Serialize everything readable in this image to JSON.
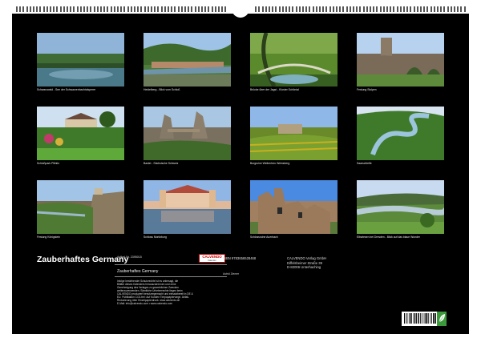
{
  "calendar": {
    "title": "Zauberhaftes Germany",
    "photos": [
      {
        "caption": "Schwarzwald - See der Schwarzenbachtalsperre",
        "icon": "lake-reflection"
      },
      {
        "caption": "Heidelberg - Blick vom Schloß",
        "icon": "town-valley"
      },
      {
        "caption": "Brücke über der Jagst - Kloster Schöntal",
        "icon": "forest-bridge"
      },
      {
        "caption": "Festung Stolpen",
        "icon": "castle-ruin-arch"
      },
      {
        "caption": "Schloßpark Pillnitz",
        "icon": "palace-garden"
      },
      {
        "caption": "Bastei - Sächsische Schweiz",
        "icon": "rock-bridge"
      },
      {
        "caption": "Burgruine Weibertreu Weinsberg",
        "icon": "vineyard-ruin"
      },
      {
        "caption": "Saarschleife",
        "icon": "river-bend"
      },
      {
        "caption": "Festung Königstein",
        "icon": "fortress-cliff"
      },
      {
        "caption": "Schloss Moritzburg",
        "icon": "baroque-palace"
      },
      {
        "caption": "Schlossruine Auerbach",
        "icon": "stone-ruin"
      },
      {
        "caption": "Elbwiesen bei Dresden - Blick auf das blaue Wunder",
        "icon": "river-meadow"
      }
    ]
  },
  "info": {
    "article_number": "Artikel-Nr. 2395015",
    "logo_text": "CALVENDO",
    "logo_subtext": "Kalender",
    "calendar_name": "Zauberhaftes Germany",
    "legal_text": "Infolge bestehender Schutzrechte ist es untersagt, die\nBlätter dieses Kalenders herauszutrennen und ohne\nGenehmigung des Verlages zu gewerblichen Zwecken\nweiterzuverwenden. Sämtliche Urheberrechte liegen beim\nCALVENDO produziert benutzergemacht und einsatzbereit in DE &\nEU. Publikation CO2-frei: Auf Kunden Tierpapapierwege. Abfall-\nReduzierung über Einzelpapierdruck. www.calvendo.de\nE-Mail: info@calvendo.com • www.calvendo.com",
    "isbn": "ISBN 9783656528468",
    "author": "Astrid Ziemer",
    "publisher": "CALVENDO Verlag GmbH\nDiffelsheimer Straße 39\nD-82006 Unterhaching"
  }
}
